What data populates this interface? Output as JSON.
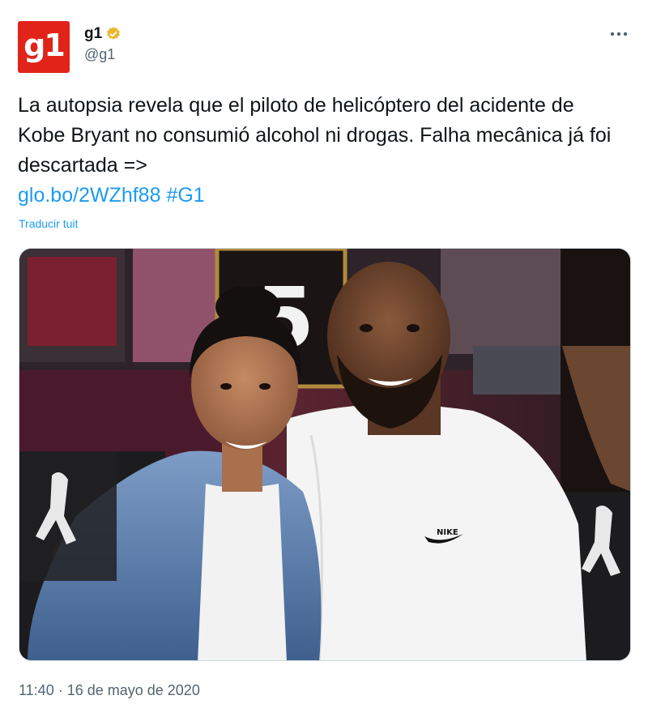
{
  "author": {
    "display_name": "g1",
    "handle": "@g1",
    "avatar_text": "g1",
    "verified": true,
    "brand_color": "#e2231a"
  },
  "menu": {
    "icon": "more-options-icon"
  },
  "tweet": {
    "text_main": "La autopsia revela que el piloto de helicóptero del acidente de Kobe Bryant no consumió alcohol ni drogas. Falha mecânica já foi descartada =>",
    "link_text": "glo.bo/2WZhf88",
    "hashtag": "#G1",
    "translate_label": "Traducir tuit",
    "timestamp": "11:40 · 16 de mayo de 2020"
  },
  "media": {
    "kind": "photo",
    "jersey_number": "5",
    "shirt_logo": "NIKE"
  },
  "colors": {
    "link": "#1d9bf0",
    "secondary_text": "#536471",
    "primary_text": "#0f1419"
  }
}
